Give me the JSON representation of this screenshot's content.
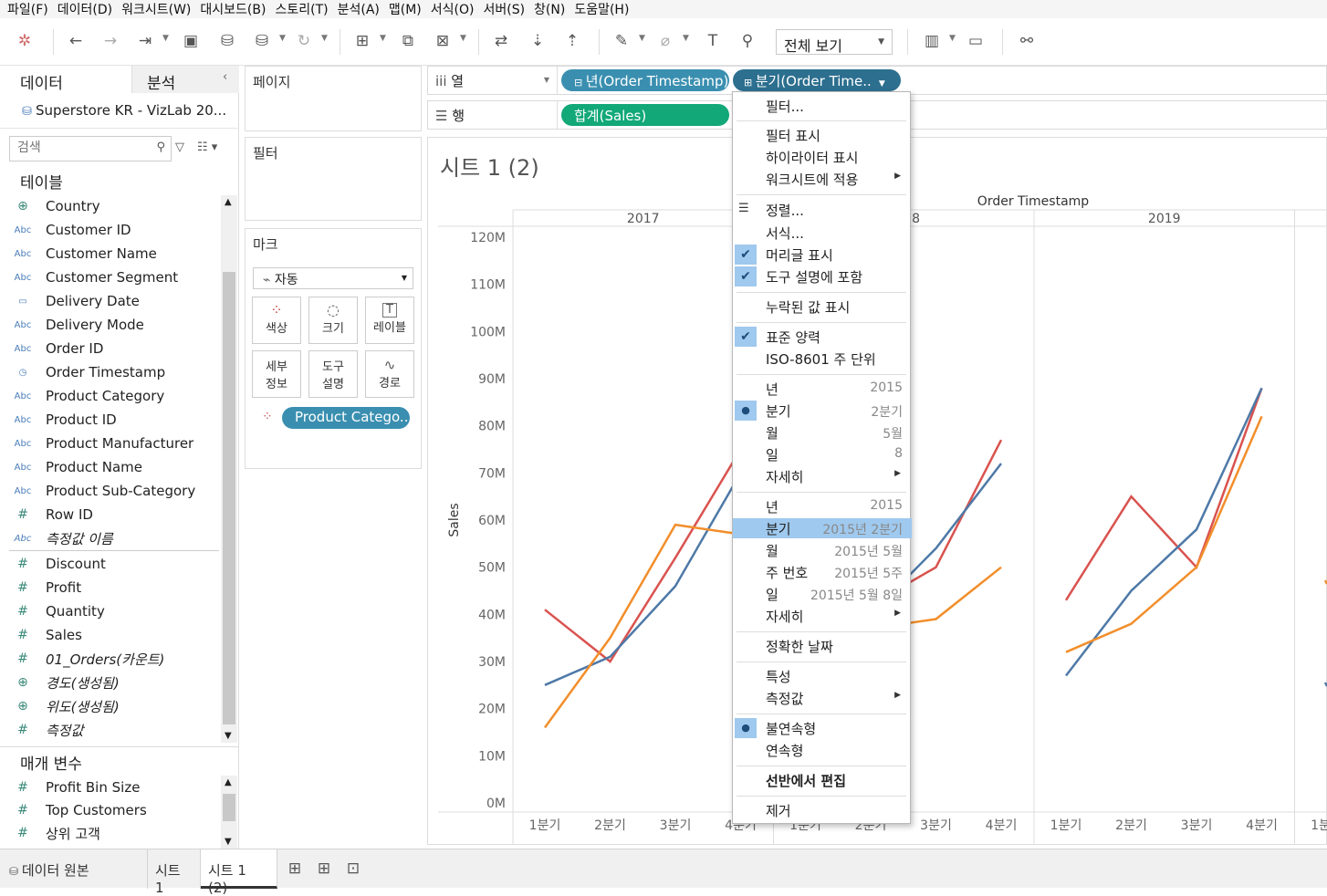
{
  "menubar": [
    "파일(F)",
    "데이터(D)",
    "워크시트(W)",
    "대시보드(B)",
    "스토리(T)",
    "분석(A)",
    "맵(M)",
    "서식(O)",
    "서버(S)",
    "창(N)",
    "도움말(H)"
  ],
  "toolbar": {
    "view_select": "전체 보기"
  },
  "left": {
    "tab_data": "데이터",
    "tab_analysis": "분석",
    "datasource": "Superstore KR - VizLab 20...",
    "search_placeholder": "검색",
    "tables_header": "테이블",
    "params_header": "매개 변수"
  },
  "fields": [
    {
      "icon": "globe",
      "name": "Country"
    },
    {
      "icon": "Abc",
      "name": "Customer ID"
    },
    {
      "icon": "Abc",
      "name": "Customer Name"
    },
    {
      "icon": "Abc",
      "name": "Customer Segment"
    },
    {
      "icon": "date",
      "name": "Delivery Date"
    },
    {
      "icon": "Abc",
      "name": "Delivery Mode"
    },
    {
      "icon": "Abc",
      "name": "Order ID"
    },
    {
      "icon": "datetime",
      "name": "Order Timestamp"
    },
    {
      "icon": "Abc",
      "name": "Product Category"
    },
    {
      "icon": "Abc",
      "name": "Product ID"
    },
    {
      "icon": "Abc",
      "name": "Product Manufacturer"
    },
    {
      "icon": "Abc",
      "name": "Product Name"
    },
    {
      "icon": "Abc",
      "name": "Product Sub-Category"
    },
    {
      "icon": "#",
      "name": "Row ID"
    },
    {
      "icon": "Abc",
      "name": "측정값 이름",
      "italic": true
    }
  ],
  "measures": [
    {
      "icon": "#",
      "name": "Discount"
    },
    {
      "icon": "#",
      "name": "Profit"
    },
    {
      "icon": "#",
      "name": "Quantity"
    },
    {
      "icon": "#",
      "name": "Sales"
    },
    {
      "icon": "#",
      "name": "01_Orders(카운트)",
      "italic": true
    },
    {
      "icon": "globe",
      "name": "경도(생성됨)",
      "italic": true
    },
    {
      "icon": "globe",
      "name": "위도(생성됨)",
      "italic": true
    },
    {
      "icon": "#",
      "name": "측정값",
      "italic": true
    }
  ],
  "params": [
    {
      "icon": "#",
      "name": "Profit Bin Size"
    },
    {
      "icon": "#",
      "name": "Top Customers"
    },
    {
      "icon": "#",
      "name": "상위 고객"
    }
  ],
  "cards": {
    "pages": "페이지",
    "filters": "필터",
    "marks": "마크",
    "mark_type": "자동",
    "color": "색상",
    "size": "크기",
    "label": "레이블",
    "detail1": "세부",
    "detail2": "정보",
    "tooltip1": "도구",
    "tooltip2": "설명",
    "path": "경로",
    "mark_pill": "Product Catego.."
  },
  "shelves": {
    "columns": "열",
    "rows": "행",
    "col_pill1": "년(Order Timestamp)",
    "col_pill2": "분기(Order Time..",
    "row_pill": "합계(Sales)"
  },
  "sheet_title": "시트 1 (2)",
  "context_menu": [
    {
      "label": "필터...",
      "y": 4
    },
    {
      "sep": true,
      "y": 31
    },
    {
      "label": "필터 표시",
      "y": 36
    },
    {
      "label": "하이라이터 표시",
      "y": 60
    },
    {
      "label": "워크시트에 적용",
      "y": 84,
      "arrow": true
    },
    {
      "sep": true,
      "y": 112
    },
    {
      "label": "정렬...",
      "y": 118,
      "icon": "sort"
    },
    {
      "label": "서식...",
      "y": 143
    },
    {
      "label": "머리글 표시",
      "y": 167,
      "check": true
    },
    {
      "label": "도구 설명에 포함",
      "y": 191,
      "check": true
    },
    {
      "sep": true,
      "y": 219
    },
    {
      "label": "누락된 값 표시",
      "y": 224
    },
    {
      "sep": true,
      "y": 252
    },
    {
      "label": "표준 양력",
      "y": 257,
      "check": true
    },
    {
      "label": "ISO-8601 주 단위",
      "y": 281
    },
    {
      "sep": true,
      "y": 309
    },
    {
      "label": "년",
      "y": 314,
      "val": "2015"
    },
    {
      "label": "분기",
      "y": 338,
      "val": "2분기",
      "dot": true
    },
    {
      "label": "월",
      "y": 362,
      "val": "5월"
    },
    {
      "label": "일",
      "y": 386,
      "val": "8"
    },
    {
      "label": "자세히",
      "y": 410,
      "arrow": true
    },
    {
      "sep": true,
      "y": 438
    },
    {
      "label": "년",
      "y": 443,
      "val": "2015"
    },
    {
      "label": "분기",
      "y": 467,
      "val": "2015년 2분기",
      "hl": true
    },
    {
      "label": "월",
      "y": 491,
      "val": "2015년 5월"
    },
    {
      "label": "주 번호",
      "y": 515,
      "val": "2015년 5주"
    },
    {
      "label": "일",
      "y": 539,
      "val": "2015년 5월 8일"
    },
    {
      "label": "자세히",
      "y": 563,
      "arrow": true
    },
    {
      "sep": true,
      "y": 591
    },
    {
      "label": "정확한 날짜",
      "y": 596
    },
    {
      "sep": true,
      "y": 624
    },
    {
      "label": "특성",
      "y": 629
    },
    {
      "label": "측정값",
      "y": 653,
      "arrow": true
    },
    {
      "sep": true,
      "y": 681
    },
    {
      "label": "불연속형",
      "y": 686,
      "dot": true
    },
    {
      "label": "연속형",
      "y": 710
    },
    {
      "sep": true,
      "y": 738
    },
    {
      "label": "선반에서 편집",
      "y": 743,
      "bold": true
    },
    {
      "sep": true,
      "y": 771
    },
    {
      "label": "제거",
      "y": 776
    }
  ],
  "bottom_tabs": [
    "데이터 원본",
    "시트 1",
    "시트 1 (2)"
  ],
  "chart_data": {
    "type": "line",
    "column_header": "Order Timestamp",
    "panels": [
      "2017",
      "2018",
      "2019"
    ],
    "categories": [
      "1분기",
      "2분기",
      "3분기",
      "4분기"
    ],
    "ylabel": "Sales",
    "yticks": [
      "0M",
      "10M",
      "20M",
      "30M",
      "40M",
      "50M",
      "60M",
      "70M",
      "80M",
      "90M",
      "100M",
      "110M",
      "120M"
    ],
    "ylim": [
      0,
      120
    ],
    "series": [
      {
        "color": "#d9534f",
        "values": [
          [
            41,
            30,
            52,
            75
          ],
          [
            35,
            42,
            50,
            77
          ],
          [
            43,
            65,
            50,
            88
          ]
        ]
      },
      {
        "color": "#4e79a7",
        "values": [
          [
            25,
            31,
            46,
            70
          ],
          [
            32,
            40,
            54,
            72
          ],
          [
            27,
            45,
            58,
            88
          ]
        ]
      },
      {
        "color": "#f28e2b",
        "values": [
          [
            16,
            35,
            59,
            57
          ],
          [
            33,
            37,
            39,
            50
          ],
          [
            32,
            38,
            50,
            82
          ]
        ]
      }
    ]
  }
}
